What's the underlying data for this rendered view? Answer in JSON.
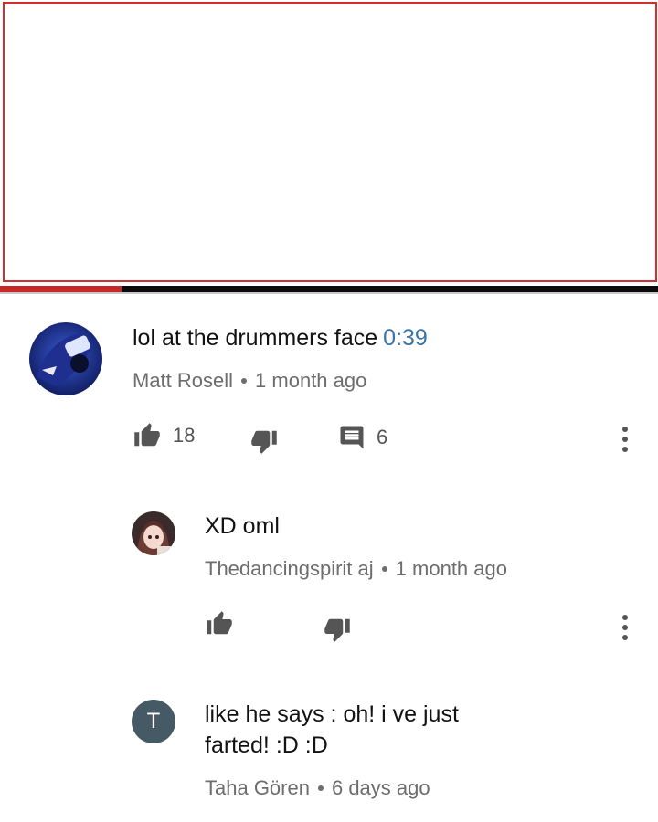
{
  "colors": {
    "progress": "#c62828",
    "link": "#3a73a8",
    "meta": "#6d6d6d",
    "avatar_letter_bg": "#455a64"
  },
  "video": {
    "progress_fraction": 0.185
  },
  "comments": [
    {
      "text": "lol at the drummers face",
      "timestamp": "0:39",
      "author": "Matt Rosell",
      "age": "1 month ago",
      "likes": "18",
      "replies": "6",
      "avatar_icon": "car-photo-avatar"
    },
    {
      "text": "XD oml",
      "author": "Thedancingspirit aj",
      "age": "1 month ago",
      "avatar_icon": "anime-girl-avatar"
    },
    {
      "text": "like he says : oh! i ve just\nfarted! :D :D",
      "author": "Taha Gören",
      "age": "6 days ago",
      "avatar_letter": "T"
    }
  ]
}
